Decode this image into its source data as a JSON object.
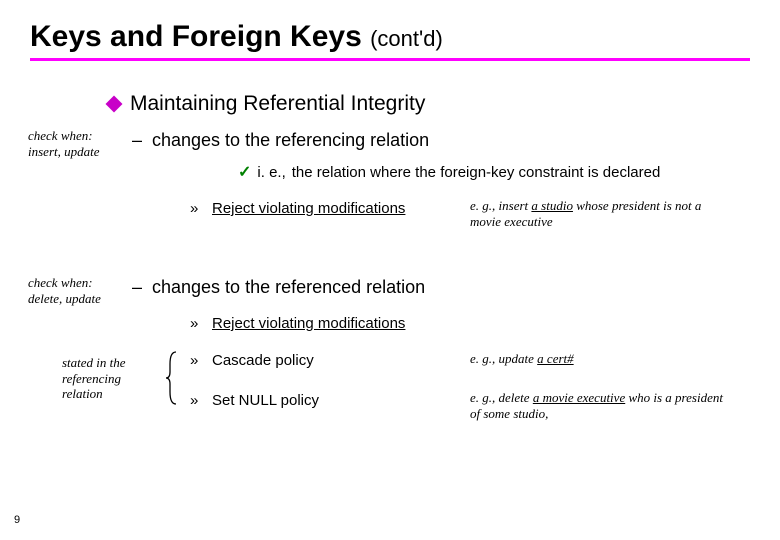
{
  "title": {
    "main": "Keys and Foreign Keys ",
    "suffix": "(cont'd)"
  },
  "main_topic": "Maintaining Referential Integrity",
  "notes": {
    "left1": "check when: insert, update",
    "left2": "check when: delete, update",
    "left3": "stated in the referencing relation"
  },
  "section1": {
    "heading": "changes to the referencing relation",
    "check_prefix": "i. e.,",
    "check_text": "the relation where the foreign-key constraint is declared",
    "sub1": "Reject violating modifications"
  },
  "section2": {
    "heading": "changes to the referenced relation",
    "sub1": "Reject violating modifications",
    "sub2": "Cascade policy",
    "sub3": "Set NULL policy"
  },
  "examples": {
    "eg_label": "e. g.,",
    "ex1_pre": "insert ",
    "ex1_u": "a studio",
    "ex1_post": " whose president is not a movie executive",
    "ex2_pre": "update ",
    "ex2_u": "a cert#",
    "ex3_pre": "delete ",
    "ex3_u": "a movie executive",
    "ex3_post": " who is a president of some studio,"
  },
  "page_number": "9"
}
